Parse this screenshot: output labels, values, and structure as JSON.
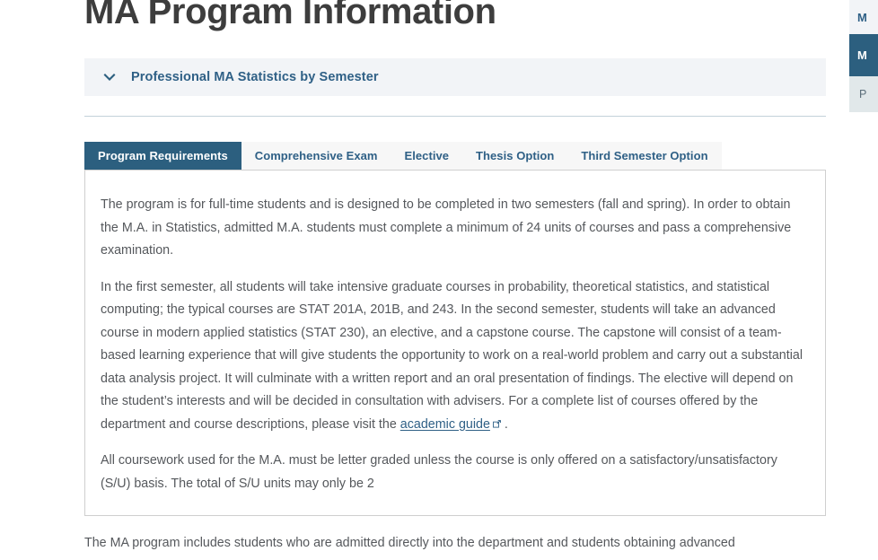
{
  "page": {
    "title": "MA Program Information"
  },
  "accordion": {
    "icon": "chevron-down-icon",
    "label": "Professional MA Statistics by Semester",
    "expanded": true
  },
  "tabs": {
    "items": [
      {
        "label": "Program Requirements",
        "active": true
      },
      {
        "label": "Comprehensive Exam",
        "active": false
      },
      {
        "label": "Elective",
        "active": false
      },
      {
        "label": "Thesis Option",
        "active": false
      },
      {
        "label": "Third Semester Option",
        "active": false
      }
    ]
  },
  "panel": {
    "paragraph_1": "The program is for full-time students and is designed to be completed in two semesters (fall and spring). In order to obtain the M.A. in Statistics, admitted M.A. students must complete a minimum of 24 units of courses and pass a comprehensive examination.",
    "paragraph_2_before_link": "In the first semester, all students will take intensive graduate courses in probability, theoretical statistics, and statistical computing; the typical courses are STAT 201A, 201B, and 243. In the second semester, students will take an advanced course in modern applied statistics (STAT 230), an elective, and a capstone course. The capstone will consist of a team-based learning experience that will give students the opportunity to work on a real-world problem and carry out a substantial data analysis project. It will culminate with a written report and an oral presentation of findings. The elective will depend on the student’s interests and will be decided in consultation with advisers. For a complete list of courses offered by the department and course descriptions, please visit the ",
    "link_text": "academic guide",
    "link_icon": "external-link-icon",
    "paragraph_2_after_link": " .",
    "paragraph_3": "All coursework used for the M.A. must be letter graded unless the course is only offered on a satisfactory/unsatisfactory (S/U) basis. The total of S/U units may only be 2"
  },
  "below_panel": {
    "text": "The MA program includes students who are admitted directly into the department and students obtaining advanced"
  },
  "side_rail": {
    "items": [
      {
        "label": "M",
        "active": false
      },
      {
        "label": "M",
        "active": true
      },
      {
        "label": "P",
        "active": false
      }
    ]
  },
  "colors": {
    "accent": "#2c5f7f",
    "link": "#2f6086",
    "body_text": "#55585c",
    "title_text": "#3d3d3d",
    "accordion_bg": "#f2f4f7",
    "tab_inactive_bg": "#f7f7f7",
    "panel_border": "#cfcfcf",
    "divider": "#c3d2da"
  }
}
